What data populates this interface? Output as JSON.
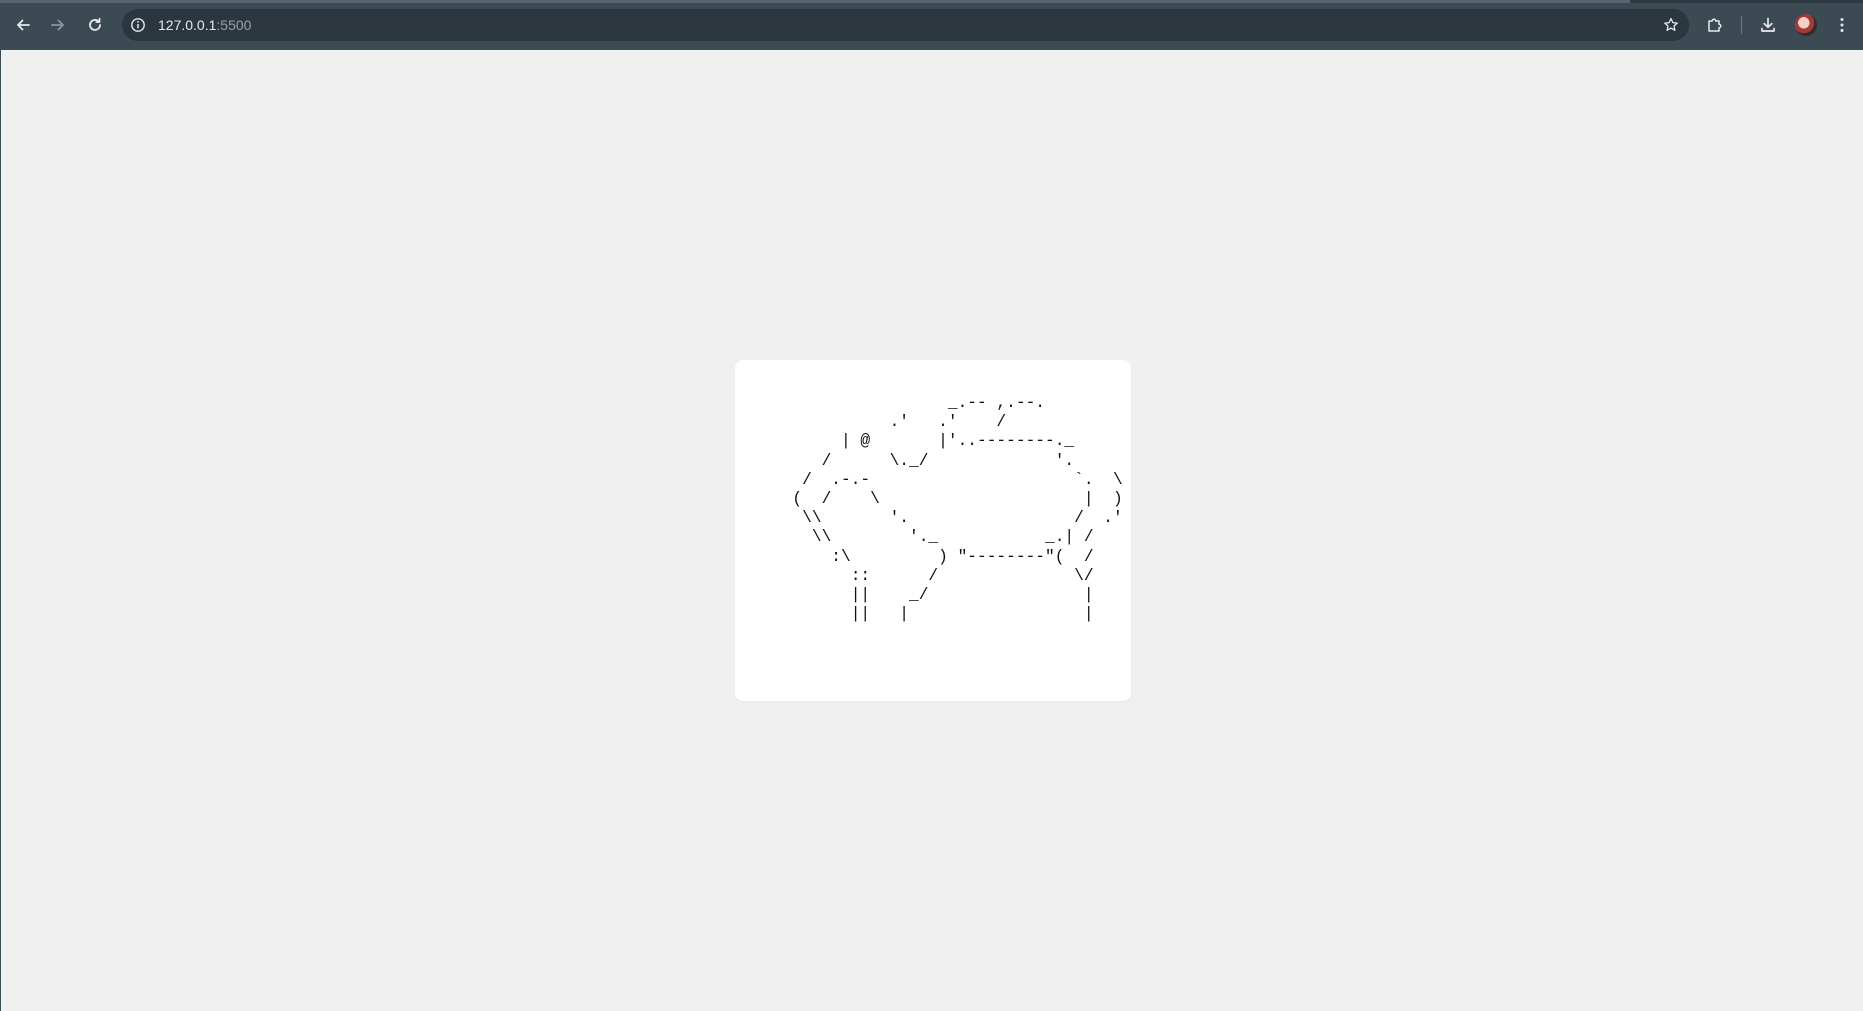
{
  "browser": {
    "url_host": "127.0.0.1",
    "url_port": ":5500",
    "icons": {
      "back": "arrow-left-icon",
      "forward": "arrow-right-icon",
      "reload": "reload-icon",
      "site_info": "info-icon",
      "bookmark": "star-icon",
      "extensions": "puzzle-icon",
      "downloads": "download-icon",
      "profile": "avatar",
      "menu": "kebab-menu-icon"
    },
    "colors": {
      "toolbar": "#3c4a54",
      "omnibox": "#2b363e",
      "page_background": "#f0f0f0",
      "card_background": "#ffffff"
    }
  },
  "page": {
    "ascii_art": "                  _.-- ,.--.\n            .'   .'    /\n       | @       |'..--------._\n     /      \\._/             '.\n   /  .-.-                     `.  \\\n  (  /    \\                     |  )\n   \\\\       '.                 /  .'\n    \\\\        '._           _.| /\n      :\\         ) \"--------\"(  /\n        ::      /              \\/\n        ||    _/                |\n        ||   |                  |"
  }
}
